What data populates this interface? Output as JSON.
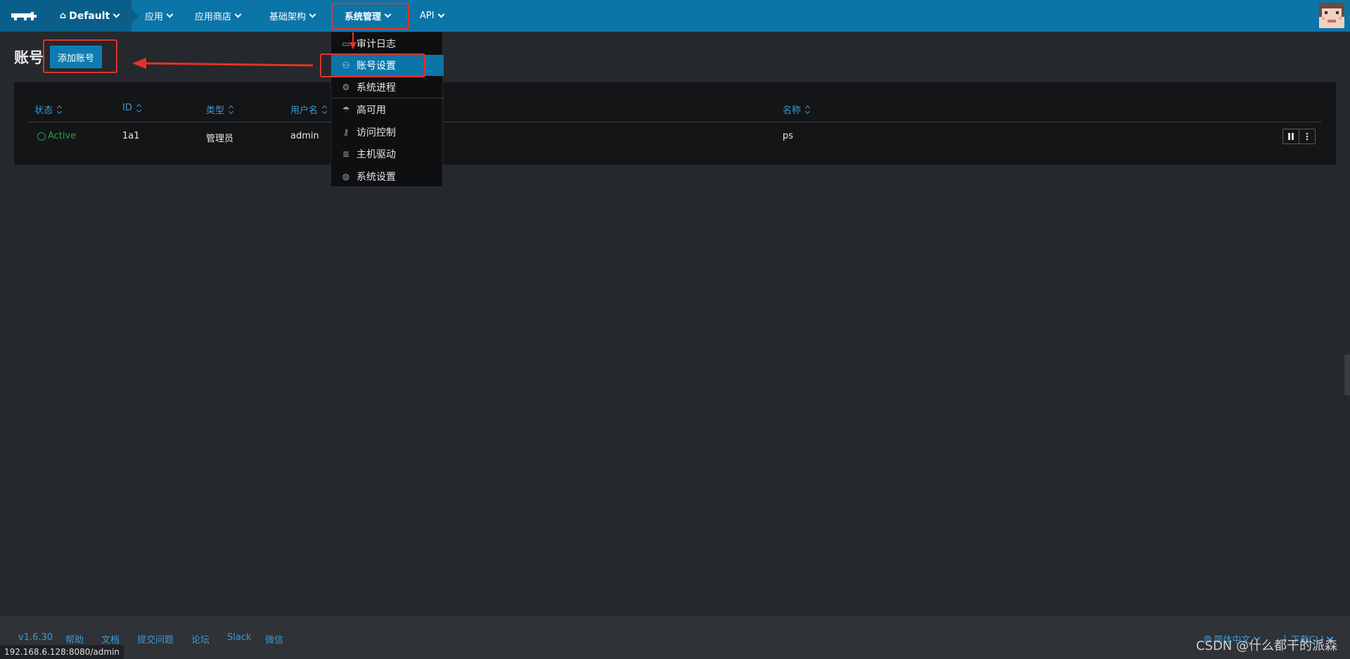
{
  "topnav": {
    "environment": "Default",
    "menu": [
      {
        "label": "应用"
      },
      {
        "label": "应用商店"
      },
      {
        "label": "基础架构"
      },
      {
        "label": "系统管理"
      },
      {
        "label": "API"
      }
    ]
  },
  "page": {
    "title": "账号",
    "add_button": "添加账号"
  },
  "table": {
    "columns": [
      "状态",
      "ID",
      "类型",
      "用户名",
      "名称"
    ],
    "rows": [
      {
        "status": "Active",
        "id": "1a1",
        "type": "管理员",
        "username": "admin",
        "name": "ps"
      }
    ]
  },
  "dropdown": {
    "items": [
      {
        "label": "审计日志",
        "icon": "audit-log-icon"
      },
      {
        "label": "账号设置",
        "icon": "accounts-icon"
      },
      {
        "label": "系统进程",
        "icon": "gear-icon"
      },
      {
        "label": "高可用",
        "icon": "umbrella-icon"
      },
      {
        "label": "访问控制",
        "icon": "key-icon"
      },
      {
        "label": "主机驱动",
        "icon": "server-icon"
      },
      {
        "label": "系统设置",
        "icon": "globe-icon"
      }
    ],
    "selected": "账号设置"
  },
  "footer": {
    "version": "v1.6.30",
    "links": [
      "帮助",
      "文档",
      "提交问题",
      "论坛",
      "Slack",
      "微信"
    ],
    "language": "简体中文",
    "download": "下载CLI",
    "status_url": "192.168.6.128:8080/admin",
    "watermark": "CSDN @什么都干的派森"
  },
  "colors": {
    "nav": "#0b75a8",
    "accent_link": "#3a9bd6",
    "active_status": "#2d9d4c",
    "annotation_red": "#e23228"
  }
}
